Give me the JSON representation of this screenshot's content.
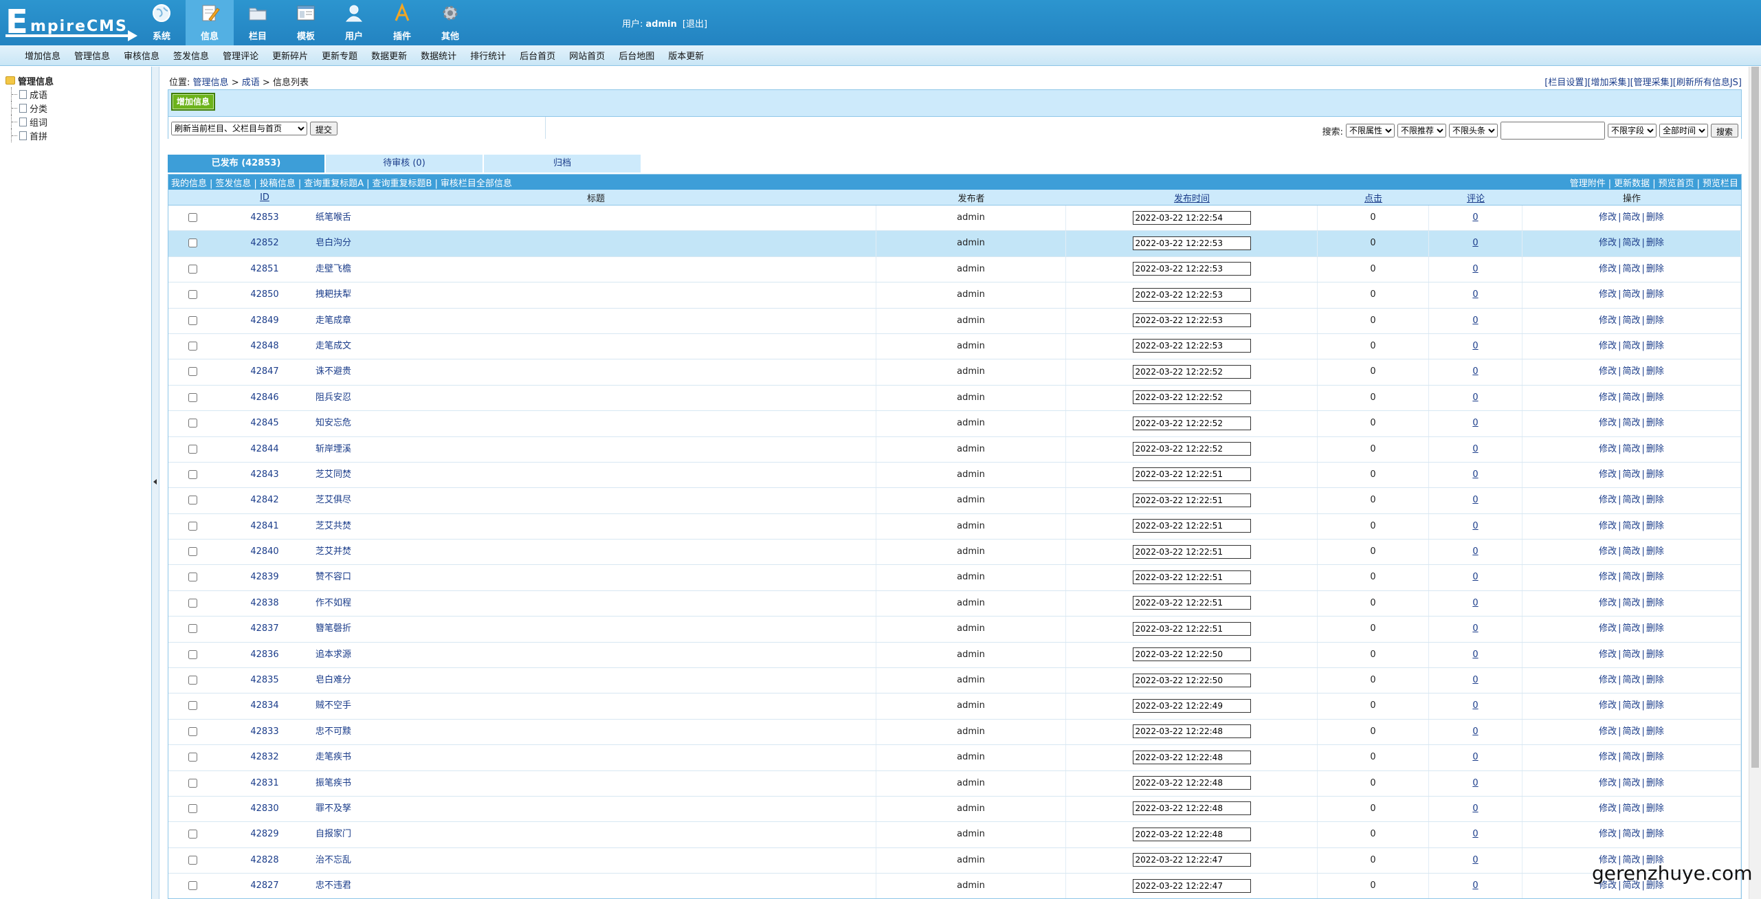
{
  "logo": {
    "big": "E",
    "rest": "mpireCMS"
  },
  "topnav": [
    {
      "label": "系统",
      "icon": "globe-icon",
      "active": false
    },
    {
      "label": "信息",
      "icon": "pencil-note-icon",
      "active": true
    },
    {
      "label": "栏目",
      "icon": "folder-icon",
      "active": false
    },
    {
      "label": "模板",
      "icon": "template-window-icon",
      "active": false
    },
    {
      "label": "用户",
      "icon": "user-icon",
      "active": false
    },
    {
      "label": "插件",
      "icon": "tools-icon",
      "active": false
    },
    {
      "label": "其他",
      "icon": "gear-icon",
      "active": false
    }
  ],
  "user": {
    "prefix": "用户:",
    "name": "admin",
    "logout": "[退出]"
  },
  "menubar": [
    "增加信息",
    "管理信息",
    "审核信息",
    "签发信息",
    "管理评论",
    "更新碎片",
    "更新专题",
    "数据更新",
    "数据统计",
    "排行统计",
    "后台首页",
    "网站首页",
    "后台地图",
    "版本更新"
  ],
  "sidebar": {
    "root": "管理信息",
    "items": [
      "成语",
      "分类",
      "组词",
      "首拼"
    ]
  },
  "location": {
    "prefix": "位置:",
    "crumb1": "管理信息",
    "sep1": ">",
    "crumb2": "成语",
    "sep2": ">",
    "current": "信息列表"
  },
  "toplinks": [
    "[栏目设置]",
    "[增加采集]",
    "[管理采集]",
    "[刷新所有信息JS]"
  ],
  "toolbar": {
    "add_info": "增加信息",
    "refresh_option": "刷新当前栏目、父栏目与首页",
    "submit": "提交",
    "search_label": "搜索:",
    "filter_attr": "不限属性",
    "filter_rec": "不限推荐",
    "filter_head": "不限头条",
    "search_value": "",
    "filter_field": "不限字段",
    "filter_time": "全部时间",
    "search_btn": "搜索"
  },
  "tabs": [
    {
      "label": "已发布 (42853)",
      "active": true
    },
    {
      "label": "待审核 (0)",
      "active": false
    },
    {
      "label": "归档",
      "active": false
    }
  ],
  "links_left": [
    "我的信息",
    "签发信息",
    "投稿信息",
    "查询重复标题A",
    "查询重复标题B",
    "审核栏目全部信息"
  ],
  "links_right": [
    "管理附件",
    "更新数据",
    "预览首页",
    "预览栏目"
  ],
  "columns": {
    "id": "ID",
    "title": "标题",
    "author": "发布者",
    "time": "发布时间",
    "click": "点击",
    "comment": "评论",
    "ops": "操作"
  },
  "ops": {
    "edit": "修改",
    "quick": "简改",
    "delete": "删除"
  },
  "rows": [
    {
      "id": "42853",
      "title": "纸笔喉舌",
      "author": "admin",
      "time": "2022-03-22 12:22:54",
      "click": "0",
      "comment": "0"
    },
    {
      "id": "42852",
      "title": "皂白沟分",
      "author": "admin",
      "time": "2022-03-22 12:22:53",
      "click": "0",
      "comment": "0"
    },
    {
      "id": "42851",
      "title": "走壁飞檐",
      "author": "admin",
      "time": "2022-03-22 12:22:53",
      "click": "0",
      "comment": "0"
    },
    {
      "id": "42850",
      "title": "拽耙扶犁",
      "author": "admin",
      "time": "2022-03-22 12:22:53",
      "click": "0",
      "comment": "0"
    },
    {
      "id": "42849",
      "title": "走笔成章",
      "author": "admin",
      "time": "2022-03-22 12:22:53",
      "click": "0",
      "comment": "0"
    },
    {
      "id": "42848",
      "title": "走笔成文",
      "author": "admin",
      "time": "2022-03-22 12:22:53",
      "click": "0",
      "comment": "0"
    },
    {
      "id": "42847",
      "title": "诛不避贵",
      "author": "admin",
      "time": "2022-03-22 12:22:52",
      "click": "0",
      "comment": "0"
    },
    {
      "id": "42846",
      "title": "阻兵安忍",
      "author": "admin",
      "time": "2022-03-22 12:22:52",
      "click": "0",
      "comment": "0"
    },
    {
      "id": "42845",
      "title": "知安忘危",
      "author": "admin",
      "time": "2022-03-22 12:22:52",
      "click": "0",
      "comment": "0"
    },
    {
      "id": "42844",
      "title": "斩岸堙溪",
      "author": "admin",
      "time": "2022-03-22 12:22:52",
      "click": "0",
      "comment": "0"
    },
    {
      "id": "42843",
      "title": "芝艾同焚",
      "author": "admin",
      "time": "2022-03-22 12:22:51",
      "click": "0",
      "comment": "0"
    },
    {
      "id": "42842",
      "title": "芝艾俱尽",
      "author": "admin",
      "time": "2022-03-22 12:22:51",
      "click": "0",
      "comment": "0"
    },
    {
      "id": "42841",
      "title": "芝艾共焚",
      "author": "admin",
      "time": "2022-03-22 12:22:51",
      "click": "0",
      "comment": "0"
    },
    {
      "id": "42840",
      "title": "芝艾并焚",
      "author": "admin",
      "time": "2022-03-22 12:22:51",
      "click": "0",
      "comment": "0"
    },
    {
      "id": "42839",
      "title": "赞不容口",
      "author": "admin",
      "time": "2022-03-22 12:22:51",
      "click": "0",
      "comment": "0"
    },
    {
      "id": "42838",
      "title": "作不如程",
      "author": "admin",
      "time": "2022-03-22 12:22:51",
      "click": "0",
      "comment": "0"
    },
    {
      "id": "42837",
      "title": "簪笔磬折",
      "author": "admin",
      "time": "2022-03-22 12:22:51",
      "click": "0",
      "comment": "0"
    },
    {
      "id": "42836",
      "title": "追本求源",
      "author": "admin",
      "time": "2022-03-22 12:22:50",
      "click": "0",
      "comment": "0"
    },
    {
      "id": "42835",
      "title": "皂白难分",
      "author": "admin",
      "time": "2022-03-22 12:22:50",
      "click": "0",
      "comment": "0"
    },
    {
      "id": "42834",
      "title": "贼不空手",
      "author": "admin",
      "time": "2022-03-22 12:22:49",
      "click": "0",
      "comment": "0"
    },
    {
      "id": "42833",
      "title": "忠不可黩",
      "author": "admin",
      "time": "2022-03-22 12:22:48",
      "click": "0",
      "comment": "0"
    },
    {
      "id": "42832",
      "title": "走笔疾书",
      "author": "admin",
      "time": "2022-03-22 12:22:48",
      "click": "0",
      "comment": "0"
    },
    {
      "id": "42831",
      "title": "振笔疾书",
      "author": "admin",
      "time": "2022-03-22 12:22:48",
      "click": "0",
      "comment": "0"
    },
    {
      "id": "42830",
      "title": "罪不及孥",
      "author": "admin",
      "time": "2022-03-22 12:22:48",
      "click": "0",
      "comment": "0"
    },
    {
      "id": "42829",
      "title": "自报家门",
      "author": "admin",
      "time": "2022-03-22 12:22:48",
      "click": "0",
      "comment": "0"
    },
    {
      "id": "42828",
      "title": "治不忘乱",
      "author": "admin",
      "time": "2022-03-22 12:22:47",
      "click": "0",
      "comment": "0"
    },
    {
      "id": "42827",
      "title": "忠不违君",
      "author": "admin",
      "time": "2022-03-22 12:22:47",
      "click": "0",
      "comment": "0"
    }
  ],
  "highlight_row_id": "42852",
  "watermark": "gerenzhuye.com"
}
